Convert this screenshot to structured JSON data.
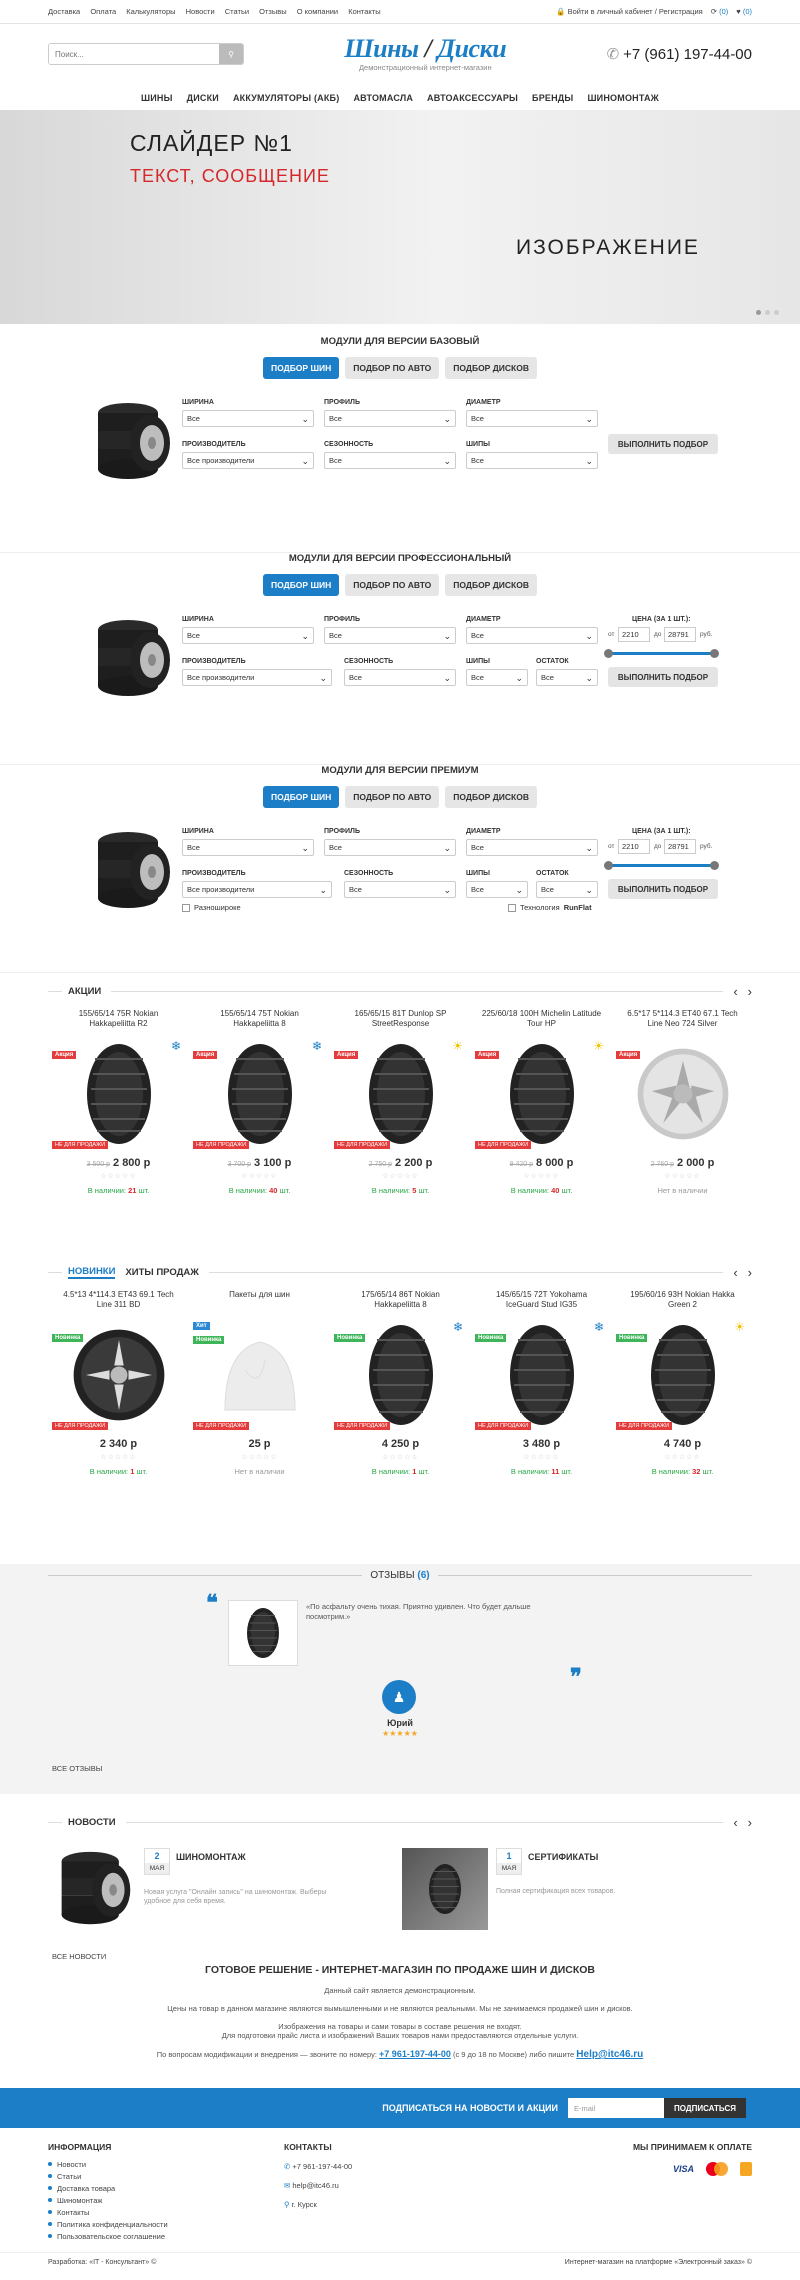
{
  "topbar": {
    "links": [
      "Доставка",
      "Оплата",
      "Калькуляторы",
      "Новости",
      "Статьи",
      "Отзывы",
      "О компании",
      "Контакты"
    ],
    "login": "Войти в личный кабинет / Регистрация",
    "compare_count": "(0)",
    "fav_count": "(0)"
  },
  "header": {
    "search_placeholder": "Поиск...",
    "logo_main": "Шины",
    "logo_slash": "/",
    "logo_second": "Диски",
    "logo_sub": "Демонстрационный интернет-магазин",
    "phone": "+7 (961) 197-44-00"
  },
  "nav": [
    "ШИНЫ",
    "ДИСКИ",
    "АККУМУЛЯТОРЫ (АКБ)",
    "АВТОМАСЛА",
    "АВТОАКСЕССУАРЫ",
    "БРЕНДЫ",
    "ШИНОМОНТАЖ"
  ],
  "slider": {
    "title": "СЛАЙДЕР №1",
    "text": "ТЕКСТ, СООБЩЕНИЕ",
    "image": "ИЗОБРАЖЕНИЕ"
  },
  "tabs": [
    "ПОДБОР ШИН",
    "ПОДБОР ПО АВТО",
    "ПОДБОР ДИСКОВ"
  ],
  "labels": {
    "width": "ШИРИНА",
    "profile": "ПРОФИЛЬ",
    "diameter": "ДИАМЕТР",
    "maker": "ПРОИЗВОДИТЕЛЬ",
    "season": "СЕЗОННОСТЬ",
    "spikes": "ШИПЫ",
    "stock": "ОСТАТОК",
    "price": "ЦЕНА (ЗА 1 ШТ.):",
    "all": "Все",
    "all_makers": "Все производители",
    "go": "ВЫПОЛНИТЬ ПОДБОР",
    "from": "от",
    "to": "до",
    "rub": "руб.",
    "min": "2210",
    "max": "28791",
    "wide": "Разношироке",
    "runflat_pre": "Технология ",
    "runflat": "RunFlat"
  },
  "modules": {
    "basic": "МОДУЛИ ДЛЯ ВЕРСИИ БАЗОВЫЙ",
    "pro": "МОДУЛИ ДЛЯ ВЕРСИИ ПРОФЕССИОНАЛЬНЫЙ",
    "premium": "МОДУЛИ ДЛЯ ВЕРСИИ ПРЕМИУМ"
  },
  "promo": {
    "title": "АКЦИИ",
    "items": [
      {
        "name": "155/65/14 75R Nokian Hakkapeliitta R2",
        "old": "3 500 р",
        "price": "2 800 р",
        "stock": "21",
        "season": "❄"
      },
      {
        "name": "155/65/14 75T Nokian Hakkapeliitta 8",
        "old": "3 700 р",
        "price": "3 100 р",
        "stock": "40",
        "season": "❄"
      },
      {
        "name": "165/65/15 81T Dunlop SP StreetResponse",
        "old": "2 750 р",
        "price": "2 200 р",
        "stock": "5",
        "season": "☀"
      },
      {
        "name": "225/60/18 100H Michelin Latitude Tour HP",
        "old": "9 420 р",
        "price": "8 000 р",
        "stock": "40",
        "season": "☀"
      },
      {
        "name": "6.5*17 5*114.3 ET40 67.1 Tech Line Neo 724 Silver",
        "old": "2 760 р",
        "price": "2 000 р",
        "stock": "",
        "season": ""
      }
    ]
  },
  "new_tabs": {
    "new": "НОВИНКИ",
    "hits": "ХИТЫ ПРОДАЖ"
  },
  "new_items": [
    {
      "name": "4.5*13 4*114.3 ET43 69.1 Tech Line 311 BD",
      "price": "2 340 р",
      "stock": "1",
      "badge": "Новинка"
    },
    {
      "name": "Пакеты для шин",
      "price": "25 р",
      "stock": "",
      "badge": "Хит"
    },
    {
      "name": "175/65/14 86T Nokian Hakkapeliitta 8",
      "price": "4 250 р",
      "stock": "1",
      "badge": "Новинка"
    },
    {
      "name": "145/65/15 72T Yokohama IceGuard Stud IG35",
      "price": "3 480 р",
      "stock": "11",
      "badge": "Новинка"
    },
    {
      "name": "195/60/16 93H Nokian Hakka Green 2",
      "price": "4 740 р",
      "stock": "32",
      "badge": "Новинка"
    }
  ],
  "common": {
    "instock": "В наличии:",
    "pcs": "шт.",
    "nostock": "Нет в наличии",
    "not_for_sale": "НЕ ДЛЯ ПРОДАЖИ",
    "promo_badge": "Акция",
    "stars": "☆☆☆☆☆"
  },
  "reviews": {
    "title": "ОТЗЫВЫ",
    "count": "(6)",
    "text": "«По асфальту очень тихая. Приятно удивлен. Что будет дальше посмотрим.»",
    "author": "Юрий",
    "stars": "★★★★★",
    "all": "ВСЕ ОТЗЫВЫ"
  },
  "news": {
    "title": "НОВОСТИ",
    "items": [
      {
        "day": "2",
        "month": "МАЯ",
        "head": "ШИНОМОНТАЖ",
        "text": "Новая услуга \"Онлайн запись\" на шиномонтаж. Выберы удобное для себя время."
      },
      {
        "day": "1",
        "month": "МАЯ",
        "head": "СЕРТИФИКАТЫ",
        "text": "Полная сертификация всех товаров."
      }
    ],
    "all": "ВСЕ НОВОСТИ"
  },
  "about": {
    "title": "ГОТОВОЕ РЕШЕНИЕ - ИНТЕРНЕТ-МАГАЗИН ПО ПРОДАЖЕ ШИН И ДИСКОВ",
    "l1": "Данный сайт является демонстрационным.",
    "l2": "Цены на товар в данном магазине являются вымышленными и не являются реальными. Мы не занимаемся продажей шин и дисков.",
    "l3": "Изображения на товары и сами товары в составе решения не входят.",
    "l4": "Для подготовки прайс листа и изображений Ваших товаров нами предоставляются отдельные услуги.",
    "l5a": "По вопросам модификации и внедрения — звоните по номеру:",
    "l5phone": "+7 961-197-44-00",
    "l5b": "(с 9 до 18 по Москве) либо пишите",
    "l5mail": "Help@itc46.ru"
  },
  "subscribe": {
    "label": "ПОДПИСАТЬСЯ НА НОВОСТИ И АКЦИИ",
    "placeholder": "E-mail",
    "button": "ПОДПИСАТЬСЯ"
  },
  "footer": {
    "info_title": "ИНФОРМАЦИЯ",
    "info": [
      "Новости",
      "Статьи",
      "Доставка товара",
      "Шиномонтаж",
      "Контакты",
      "Политика конфиденциальности",
      "Пользовательское соглашение"
    ],
    "contacts_title": "КОНТАКТЫ",
    "phone": "+7 961-197-44-00",
    "email": "help@itc46.ru",
    "city": "г. Курск",
    "pay_title": "МЫ ПРИНИМАЕМ К ОПЛАТЕ",
    "visa": "VISA",
    "dev": "Разработка: «IT - Консультант» ©",
    "platform": "Интернет-магазин на платформе «Электронный заказ» ©"
  },
  "colors": {
    "brand": "#1c7ec6",
    "accent": "#d6282a",
    "instock": "#28a745"
  }
}
